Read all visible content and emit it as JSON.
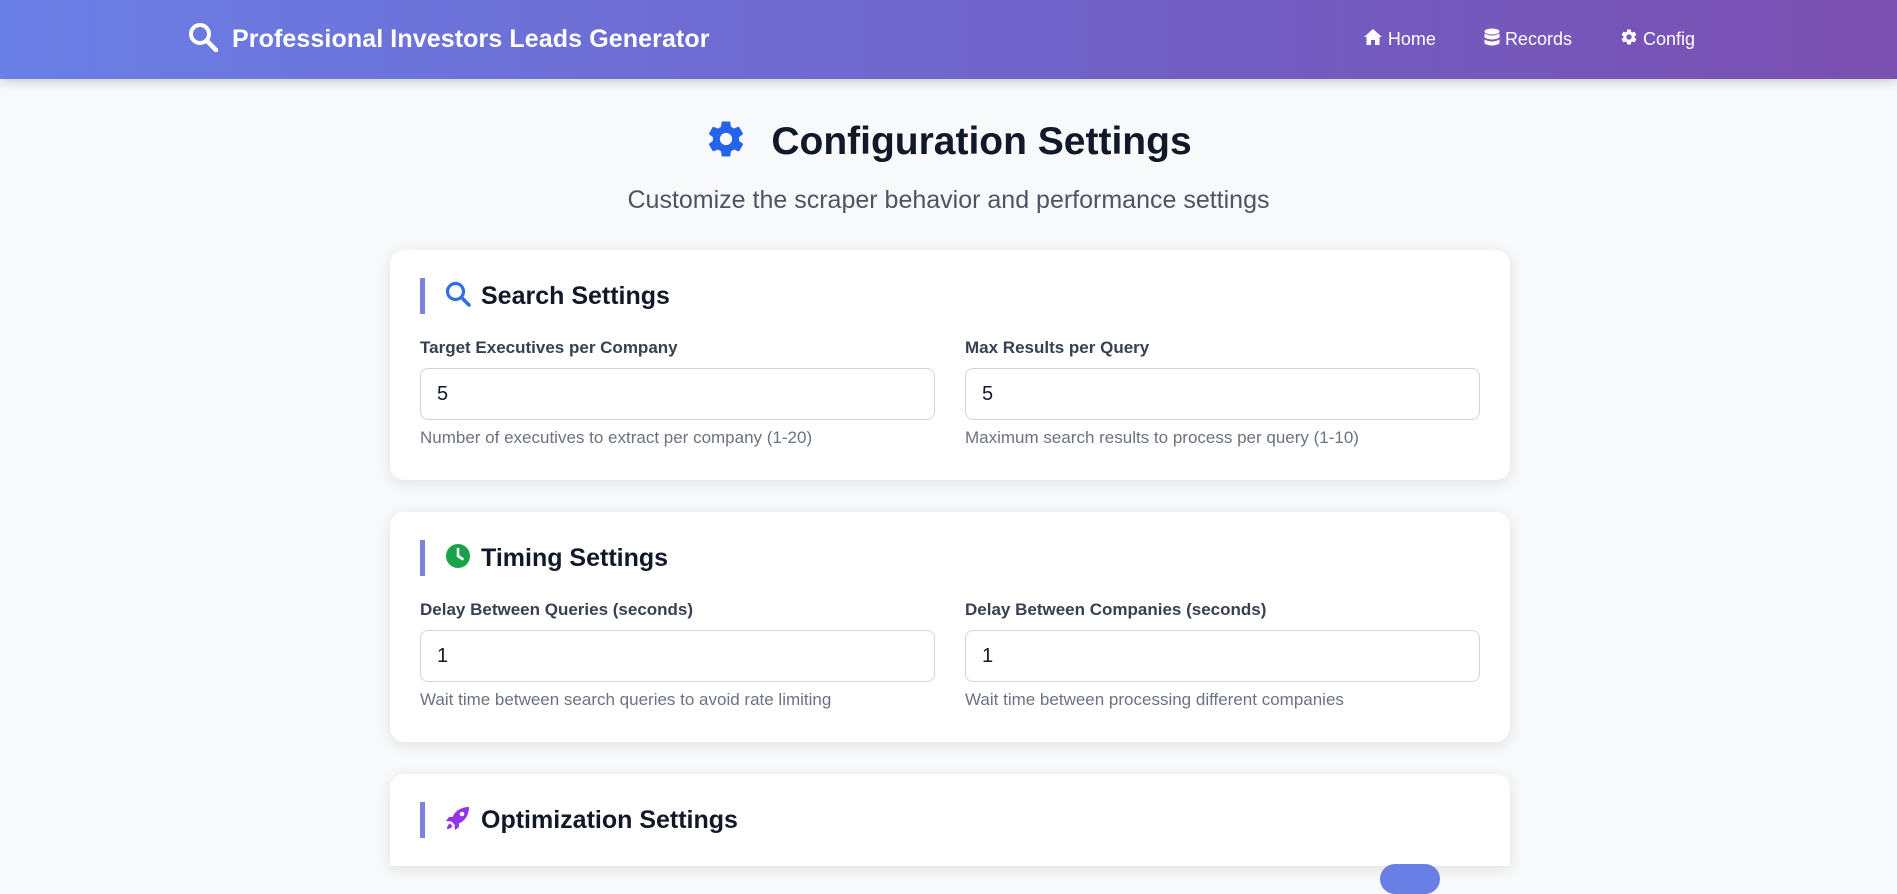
{
  "app": {
    "title": "Professional Investors Leads Generator"
  },
  "nav": [
    {
      "label": "Home",
      "icon": "home-icon"
    },
    {
      "label": "Records",
      "icon": "database-icon"
    },
    {
      "label": "Config",
      "icon": "gear-icon"
    }
  ],
  "page": {
    "title": "Configuration Settings",
    "subtitle": "Customize the scraper behavior and performance settings"
  },
  "sections": {
    "search": {
      "title": "Search Settings",
      "fields": [
        {
          "label": "Target Executives per Company",
          "value": "5",
          "help": "Number of executives to extract per company (1-20)"
        },
        {
          "label": "Max Results per Query",
          "value": "5",
          "help": "Maximum search results to process per query (1-10)"
        }
      ]
    },
    "timing": {
      "title": "Timing Settings",
      "fields": [
        {
          "label": "Delay Between Queries (seconds)",
          "value": "1",
          "help": "Wait time between search queries to avoid rate limiting"
        },
        {
          "label": "Delay Between Companies (seconds)",
          "value": "1",
          "help": "Wait time between processing different companies"
        }
      ]
    },
    "optimization": {
      "title": "Optimization Settings"
    }
  },
  "colors": {
    "accent": "#7b83df",
    "search_icon": "#2f6fe0",
    "timing_icon": "#16a34a",
    "rocket_icon": "#9333ea",
    "gear_icon": "#2563eb"
  }
}
